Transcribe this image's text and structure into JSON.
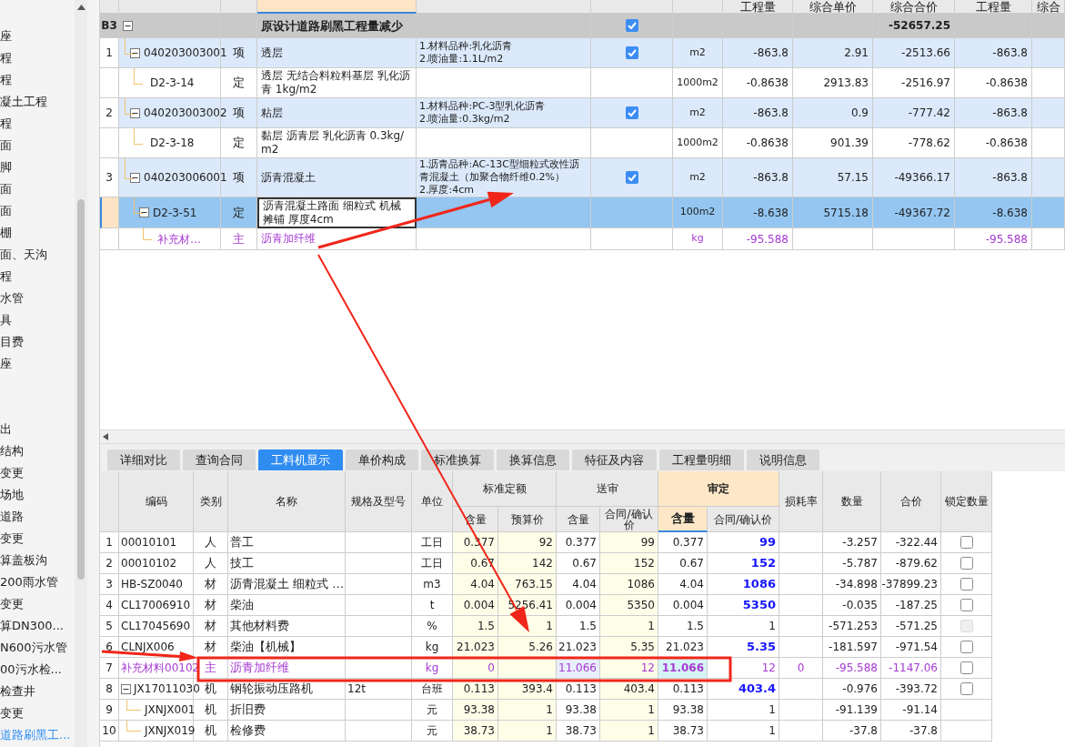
{
  "sidebar": {
    "sections": [
      [
        {
          "label": "座",
          "selected": false
        },
        {
          "label": "程",
          "selected": false
        },
        {
          "label": "程",
          "selected": false
        },
        {
          "label": "凝土工程",
          "selected": false
        },
        {
          "label": "程",
          "selected": false
        },
        {
          "label": "面",
          "selected": false
        },
        {
          "label": "脚",
          "selected": false
        },
        {
          "label": "面",
          "selected": false
        },
        {
          "label": "面",
          "selected": false
        },
        {
          "label": "棚",
          "selected": false
        },
        {
          "label": "面、天沟",
          "selected": false
        },
        {
          "label": "程",
          "selected": false
        },
        {
          "label": "水管",
          "selected": false
        },
        {
          "label": "具",
          "selected": false
        },
        {
          "label": "目费",
          "selected": false
        },
        {
          "label": "座",
          "selected": false
        }
      ],
      [
        {
          "label": "出",
          "selected": false
        },
        {
          "label": "结构",
          "selected": false
        },
        {
          "label": "变更",
          "selected": false
        },
        {
          "label": "场地",
          "selected": false
        },
        {
          "label": "道路",
          "selected": false
        },
        {
          "label": "变更",
          "selected": false
        },
        {
          "label": "算盖板沟",
          "selected": false
        },
        {
          "label": "200雨水管",
          "selected": false
        },
        {
          "label": "变更",
          "selected": false
        },
        {
          "label": "算DN300...",
          "selected": false
        },
        {
          "label": "N600污水管",
          "selected": false
        },
        {
          "label": "00污水检...",
          "selected": false
        },
        {
          "label": "检查井",
          "selected": false
        },
        {
          "label": "变更",
          "selected": false
        },
        {
          "label": "道路刷黑工...",
          "selected": true
        }
      ]
    ]
  },
  "top_table": {
    "columns": [
      {
        "selected": false
      },
      {
        "selected": false
      },
      {
        "selected": false
      },
      {
        "selected": true
      },
      {
        "selected": false
      },
      {
        "selected": false
      },
      {
        "selected": false
      },
      {
        "label": "工程量",
        "selected": false
      },
      {
        "label": "综合单价",
        "selected": false
      },
      {
        "label": "综合合价",
        "selected": false
      },
      {
        "label": "工程量",
        "selected": false
      },
      {
        "label": "综合",
        "selected": false
      }
    ],
    "rows": [
      {
        "kind": "group",
        "num": "B3",
        "name": "原设计道路刷黑工程量减少",
        "checked": true,
        "total": "-52657.25",
        "expanded": true,
        "selected": false,
        "children": [
          {
            "kind": "item",
            "num": "1",
            "code": "040203003001",
            "type": "项",
            "name": "透层",
            "features": [
              "1.材料品种:乳化沥青",
              "2.喷油量:1.1L/m2"
            ],
            "checked": true,
            "unit": "m2",
            "qty": "-863.8",
            "price": "2.91",
            "total": "-2513.66",
            "qty2": "-863.8",
            "expanded": true,
            "selected": false,
            "children": [
              {
                "kind": "quota",
                "code": "D2-3-14",
                "type": "定",
                "name": "透层 无结合料粒料基层 乳化沥青 1kg/m2",
                "unit": "1000m2",
                "qty": "-0.8638",
                "price": "2913.83",
                "total": "-2516.97",
                "qty2": "-0.8638",
                "selected": false
              }
            ]
          },
          {
            "kind": "item",
            "num": "2",
            "code": "040203003002",
            "type": "项",
            "name": "粘层",
            "features": [
              "1.材料品种:PC-3型乳化沥青",
              "2.喷油量:0.3kg/m2"
            ],
            "checked": true,
            "unit": "m2",
            "qty": "-863.8",
            "price": "0.9",
            "total": "-777.42",
            "qty2": "-863.8",
            "expanded": true,
            "selected": false,
            "children": [
              {
                "kind": "quota",
                "code": "D2-3-18",
                "type": "定",
                "name": "黏层 沥青层 乳化沥青 0.3kg/m2",
                "unit": "1000m2",
                "qty": "-0.8638",
                "price": "901.39",
                "total": "-778.62",
                "qty2": "-0.8638",
                "selected": false
              }
            ]
          },
          {
            "kind": "item",
            "num": "3",
            "code": "040203006001",
            "type": "项",
            "name": "沥青混凝土",
            "features": [
              "1.沥青品种:AC-13C型细粒式改性沥青混凝土（加聚合物纤维0.2%）",
              "2.厚度:4cm"
            ],
            "checked": true,
            "unit": "m2",
            "qty": "-863.8",
            "price": "57.15",
            "total": "-49366.17",
            "qty2": "-863.8",
            "expanded": true,
            "selected": false,
            "children": [
              {
                "kind": "quota",
                "code": "D2-3-51",
                "type": "定",
                "name": "沥青混凝土路面 细粒式 机械摊铺 厚度4cm",
                "unit": "100m2",
                "qty": "-8.638",
                "price": "5715.18",
                "total": "-49367.72",
                "qty2": "-8.638",
                "expanded": true,
                "selected": true,
                "children": [
                  {
                    "kind": "material",
                    "code": "补充材…",
                    "type": "主",
                    "name": "沥青加纤维",
                    "unit": "kg",
                    "qty": "-95.588",
                    "qty2": "-95.588",
                    "selected": false
                  }
                ]
              }
            ]
          }
        ]
      }
    ]
  },
  "tabs": [
    {
      "label": "详细对比",
      "selected": false
    },
    {
      "label": "查询合同",
      "selected": false
    },
    {
      "label": "工料机显示",
      "selected": true
    },
    {
      "label": "单价构成",
      "selected": false
    },
    {
      "label": "标准换算",
      "selected": false
    },
    {
      "label": "换算信息",
      "selected": false
    },
    {
      "label": "特征及内容",
      "selected": false
    },
    {
      "label": "工程量明细",
      "selected": false
    },
    {
      "label": "说明信息",
      "selected": false
    }
  ],
  "bottom_table": {
    "headers": [
      {
        "label": "编码",
        "selected": false
      },
      {
        "label": "类别",
        "selected": false
      },
      {
        "label": "名称",
        "selected": false
      },
      {
        "label": "规格及型号",
        "selected": false
      },
      {
        "label": "单位",
        "selected": false
      },
      {
        "label": "标准定额",
        "selected": false,
        "sub": [
          {
            "label": "含量",
            "selected": false
          },
          {
            "label": "预算价",
            "selected": false
          }
        ]
      },
      {
        "label": "送审",
        "selected": false,
        "sub": [
          {
            "label": "含量",
            "selected": false
          },
          {
            "label": "合同/确认价",
            "selected": false
          }
        ]
      },
      {
        "label": "审定",
        "selected": true,
        "sub": [
          {
            "label": "含量",
            "selected": true
          },
          {
            "label": "合同/确认价",
            "selected": false
          }
        ]
      },
      {
        "label": "损耗率",
        "selected": false
      },
      {
        "label": "数量",
        "selected": false
      },
      {
        "label": "合价",
        "selected": false
      },
      {
        "label": "锁定数量",
        "selected": false
      }
    ],
    "rows": [
      {
        "num": "1",
        "kind": "labor",
        "code": "00010101",
        "type": "人",
        "name": "普工",
        "unit": "工日",
        "std_qty": "0.377",
        "std_price": "92",
        "sub_qty": "0.377",
        "sub_price": "99",
        "app_qty": "0.377",
        "app_price": "99",
        "price_changed": true,
        "quantity": "-3.257",
        "total": "-322.44",
        "locked": false,
        "lock_disabled": false,
        "selected": false
      },
      {
        "num": "2",
        "kind": "labor",
        "code": "00010102",
        "type": "人",
        "name": "技工",
        "unit": "工日",
        "std_qty": "0.67",
        "std_price": "142",
        "sub_qty": "0.67",
        "sub_price": "152",
        "app_qty": "0.67",
        "app_price": "152",
        "price_changed": true,
        "quantity": "-5.787",
        "total": "-879.62",
        "locked": false,
        "lock_disabled": false,
        "selected": false
      },
      {
        "num": "3",
        "kind": "material",
        "code": "HB-SZ0040",
        "type": "材",
        "name": "沥青混凝土 细粒式 …",
        "unit": "m3",
        "std_qty": "4.04",
        "std_price": "763.15",
        "sub_qty": "4.04",
        "sub_price": "1086",
        "app_qty": "4.04",
        "app_price": "1086",
        "price_changed": true,
        "quantity": "-34.898",
        "total": "-37899.23",
        "locked": false,
        "lock_disabled": false,
        "selected": false
      },
      {
        "num": "4",
        "kind": "material",
        "code": "CL17006910",
        "type": "材",
        "name": "柴油",
        "unit": "t",
        "std_qty": "0.004",
        "std_price": "5256.41",
        "sub_qty": "0.004",
        "sub_price": "5350",
        "app_qty": "0.004",
        "app_price": "5350",
        "price_changed": true,
        "quantity": "-0.035",
        "total": "-187.25",
        "locked": false,
        "lock_disabled": false,
        "selected": false
      },
      {
        "num": "5",
        "kind": "material",
        "code": "CL17045690",
        "type": "材",
        "name": "其他材料费",
        "unit": "%",
        "std_qty": "1.5",
        "std_price": "1",
        "sub_qty": "1.5",
        "sub_price": "1",
        "app_qty": "1.5",
        "app_price": "1",
        "price_changed": false,
        "quantity": "-571.253",
        "total": "-571.25",
        "locked": false,
        "lock_disabled": true,
        "selected": false
      },
      {
        "num": "6",
        "kind": "material",
        "code": "CLNJX006",
        "type": "材",
        "name": "柴油【机械】",
        "unit": "kg",
        "std_qty": "21.023",
        "std_price": "5.26",
        "sub_qty": "21.023",
        "sub_price": "5.35",
        "app_qty": "21.023",
        "app_price": "5.35",
        "price_changed": true,
        "quantity": "-181.597",
        "total": "-971.54",
        "locked": false,
        "lock_disabled": false,
        "selected": false
      },
      {
        "num": "7",
        "kind": "main",
        "code": "补充材料00102",
        "type": "主",
        "name": "沥青加纤维",
        "unit": "kg",
        "std_qty": "0",
        "sub_qty": "11.066",
        "sub_price": "12",
        "app_qty": "11.066",
        "app_price": "12",
        "price_changed": false,
        "loss": "0",
        "quantity": "-95.588",
        "total": "-1147.06",
        "locked": false,
        "lock_disabled": false,
        "selected": true
      },
      {
        "num": "8",
        "kind": "machine",
        "code": "JX17011030",
        "type": "机",
        "name": "钢轮振动压路机",
        "spec": "12t",
        "unit": "台班",
        "std_qty": "0.113",
        "std_price": "393.4",
        "sub_qty": "0.113",
        "sub_price": "403.4",
        "app_qty": "0.113",
        "app_price": "403.4",
        "price_changed": true,
        "quantity": "-0.976",
        "total": "-393.72",
        "locked": false,
        "lock_disabled": false,
        "selected": false,
        "expanded": true,
        "children": [
          {
            "num": "9",
            "kind": "machine",
            "code": "JXNJX001",
            "type": "机",
            "name": "折旧费",
            "unit": "元",
            "std_qty": "93.38",
            "std_price": "1",
            "sub_qty": "93.38",
            "sub_price": "1",
            "app_qty": "93.38",
            "app_price": "1",
            "price_changed": false,
            "quantity": "-91.139",
            "total": "-91.14",
            "selected": false
          },
          {
            "num": "10",
            "kind": "machine",
            "code": "JXNJX019",
            "type": "机",
            "name": "检修费",
            "unit": "元",
            "std_qty": "38.73",
            "std_price": "1",
            "sub_qty": "38.73",
            "sub_price": "1",
            "app_qty": "38.73",
            "app_price": "1",
            "price_changed": false,
            "quantity": "-37.8",
            "total": "-37.8",
            "selected": false
          }
        ]
      }
    ]
  }
}
